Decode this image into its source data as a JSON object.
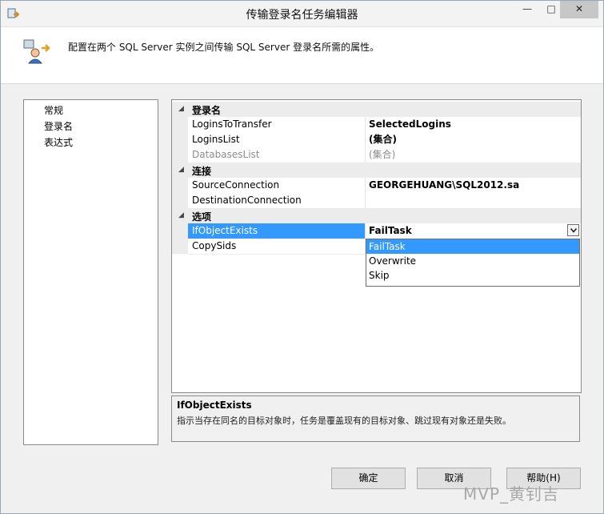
{
  "window": {
    "title": "传输登录名任务编辑器",
    "controls": {
      "minimize": "—",
      "maximize": "□",
      "close": "✕"
    }
  },
  "header": {
    "description": "配置在两个 SQL Server 实例之间传输 SQL Server 登录名所需的属性。"
  },
  "nav": {
    "items": [
      {
        "label": "常规"
      },
      {
        "label": "登录名"
      },
      {
        "label": "表达式"
      }
    ]
  },
  "grid": {
    "categories": [
      {
        "label": "登录名",
        "rows": [
          {
            "name": "LoginsToTransfer",
            "value": "SelectedLogins"
          },
          {
            "name": "LoginsList",
            "value": "(集合)"
          },
          {
            "name": "DatabasesList",
            "value": "(集合)"
          }
        ]
      },
      {
        "label": "连接",
        "rows": [
          {
            "name": "SourceConnection",
            "value": "GEORGEHUANG\\SQL2012.sa"
          },
          {
            "name": "DestinationConnection",
            "value": ""
          }
        ]
      },
      {
        "label": "选项",
        "rows": [
          {
            "name": "IfObjectExists",
            "value": "FailTask"
          },
          {
            "name": "CopySids",
            "value": ""
          }
        ]
      }
    ],
    "dropdown": {
      "options": [
        "FailTask",
        "Overwrite",
        "Skip"
      ],
      "selected": "FailTask"
    }
  },
  "description_panel": {
    "title": "IfObjectExists",
    "text": "指示当存在同名的目标对象时，任务是覆盖现有的目标对象、跳过现有对象还是失败。"
  },
  "buttons": {
    "ok": "确定",
    "cancel": "取消",
    "help": "帮助(H)"
  },
  "watermark": "MVP_黄钊吉",
  "colors": {
    "selection": "#3399ff",
    "category_bg": "#ececec"
  }
}
